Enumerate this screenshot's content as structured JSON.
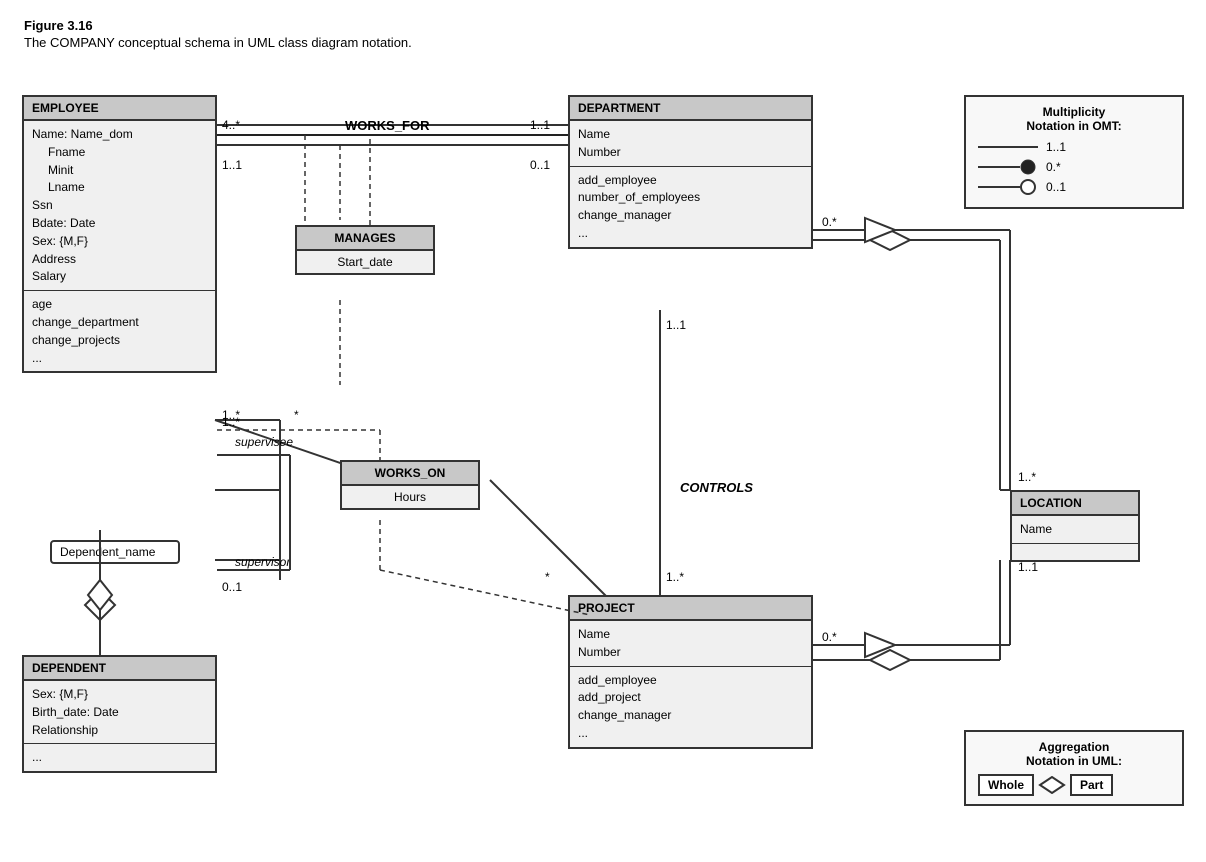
{
  "figure": {
    "title": "Figure 3.16",
    "caption": "The COMPANY conceptual schema in UML class diagram notation."
  },
  "classes": {
    "employee": {
      "header": "EMPLOYEE",
      "section1": [
        "Name: Name_dom",
        "Fname",
        "Minit",
        "Lname",
        "Ssn",
        "Bdate: Date",
        "Sex: {M,F}",
        "Address",
        "Salary"
      ],
      "section2": [
        "age",
        "change_department",
        "change_projects",
        "..."
      ]
    },
    "department": {
      "header": "DEPARTMENT",
      "section1": [
        "Name",
        "Number"
      ],
      "section2": [
        "add_employee",
        "number_of_employees",
        "change_manager",
        "..."
      ]
    },
    "project": {
      "header": "PROJECT",
      "section1": [
        "Name",
        "Number"
      ],
      "section2": [
        "add_employee",
        "add_project",
        "change_manager",
        "..."
      ]
    },
    "dependent": {
      "header": "DEPENDENT",
      "section1": [
        "Sex: {M,F}",
        "Birth_date: Date",
        "Relationship"
      ],
      "section2": [
        "..."
      ]
    },
    "location": {
      "header": "LOCATION",
      "section1": [
        "Name"
      ],
      "section2": []
    }
  },
  "assoc_boxes": {
    "manages": {
      "header": "MANAGES",
      "body": "Start_date"
    },
    "works_on": {
      "header": "WORKS_ON",
      "body": "Hours"
    }
  },
  "labels": {
    "works_for": "WORKS_FOR",
    "controls": "CONTROLS",
    "supervisee": "supervisee",
    "supervisor": "supervisor",
    "dependent_name": "Dependent_name",
    "mult_11_1": "1..1",
    "mult_4star": "4..*",
    "mult_11_2": "1..1",
    "mult_01_1": "0..1",
    "mult_1star_1": "1..*",
    "mult_star_1": "*",
    "mult_01_2": "0..1",
    "mult_1star_2": "1..*",
    "mult_star_2": "*",
    "mult_0star_1": "0.*",
    "mult_11_3": "1..1",
    "mult_1star_3": "1..*",
    "mult_0star_2": "0.*",
    "mult_11_4": "1..1"
  },
  "multiplicity_legend": {
    "title1": "Multiplicity",
    "title2": "Notation in OMT:",
    "rows": [
      {
        "label": "1..1"
      },
      {
        "label": "0.*"
      },
      {
        "label": "0..1"
      }
    ]
  },
  "aggregation_legend": {
    "title1": "Aggregation",
    "title2": "Notation in UML:",
    "whole": "Whole",
    "part": "Part"
  }
}
